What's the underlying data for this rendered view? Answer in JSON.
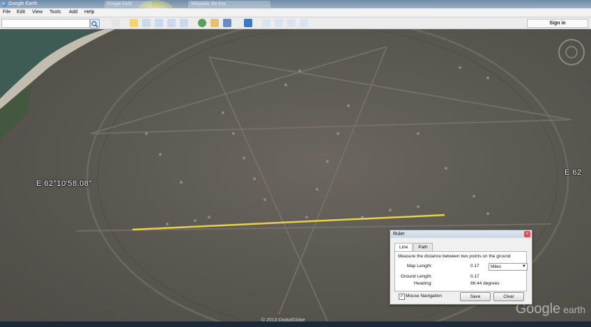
{
  "window": {
    "title": "Google Earth",
    "tabs": [
      "Google Earth",
      "Wikipedia, the free"
    ]
  },
  "menu": {
    "items": [
      "File",
      "Edit",
      "View",
      "Tools",
      "Add",
      "Help"
    ]
  },
  "toolbar": {
    "search_icon": "search-icon",
    "sign_in_label": "Sign in"
  },
  "map": {
    "coord_left": "E 62°10'58.08\"",
    "coord_right": "E 62",
    "watermark_main": "Google",
    "watermark_sub": " earth",
    "attribution": "© 2013 DigitalGlobe"
  },
  "ruler": {
    "title": "Ruler",
    "tabs": [
      "Line",
      "Path"
    ],
    "active_tab": "Line",
    "description": "Measure the distance between two points on the ground",
    "map_length_label": "Map Length:",
    "map_length_value": "0.17",
    "unit_selected": "Miles",
    "ground_length_label": "Ground Length:",
    "ground_length_value": "0.17",
    "heading_label": "Heading:",
    "heading_value": "86.44 degrees",
    "mouse_nav_label": "Mouse Navigation",
    "mouse_nav_checked": true,
    "save_label": "Save",
    "clear_label": "Clear"
  },
  "colors": {
    "measure_line": "#e8d24a",
    "terrain": "#5c5852",
    "water": "#3d5a4f"
  }
}
